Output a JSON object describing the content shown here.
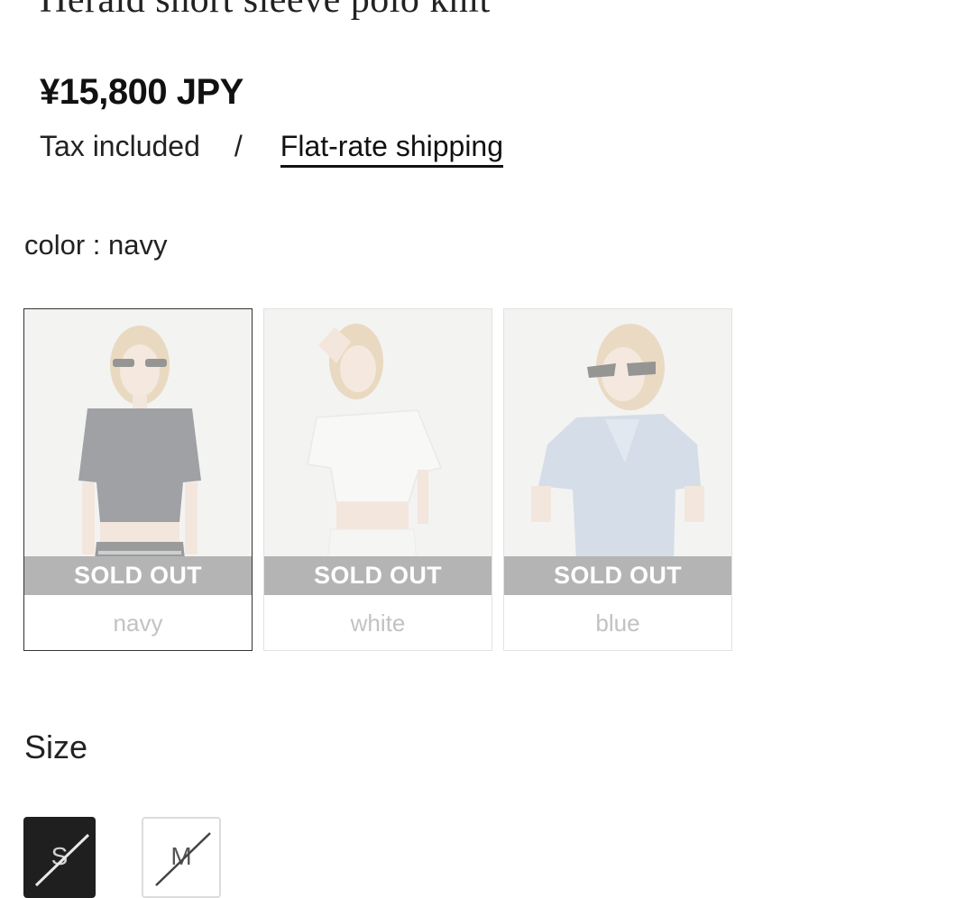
{
  "product": {
    "title": "Herald short sleeve polo knit",
    "price": "¥15,800 JPY",
    "tax_note": "Tax included",
    "separator": "/",
    "shipping_link": "Flat-rate shipping"
  },
  "color": {
    "label": "color : navy",
    "options": [
      {
        "name": "navy",
        "status": "SOLD OUT",
        "selected": true,
        "garment_color": "#2a2d36",
        "icon": "model-photo-navy"
      },
      {
        "name": "white",
        "status": "SOLD OUT",
        "selected": false,
        "garment_color": "#f2f2f0",
        "icon": "model-photo-white"
      },
      {
        "name": "blue",
        "status": "SOLD OUT",
        "selected": false,
        "garment_color": "#a9bcd8",
        "icon": "model-photo-blue"
      }
    ]
  },
  "size": {
    "label": "Size",
    "options": [
      {
        "label": "S",
        "selected": true,
        "available": false
      },
      {
        "label": "M",
        "selected": false,
        "available": false
      }
    ]
  },
  "colors": {
    "soldout_band": "#b4b4b4",
    "selected_size_bg": "#1f1f1f",
    "text": "#1a1a1a"
  }
}
